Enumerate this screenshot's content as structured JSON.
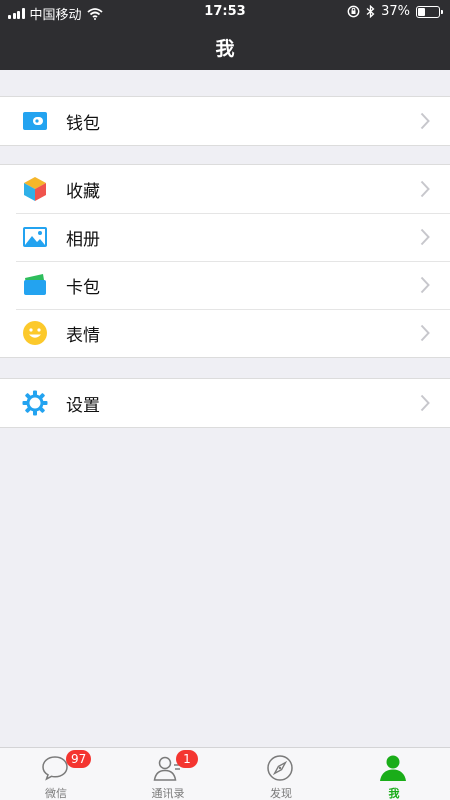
{
  "status_bar": {
    "carrier": "中国移动",
    "time": "17:53",
    "battery": "37%",
    "battery_level": 0.37
  },
  "nav": {
    "title": "我"
  },
  "groups": [
    {
      "items": [
        {
          "label": "钱包",
          "icon": "wallet-icon"
        }
      ]
    },
    {
      "items": [
        {
          "label": "收藏",
          "icon": "favorites-cube-icon"
        },
        {
          "label": "相册",
          "icon": "album-picture-icon"
        },
        {
          "label": "卡包",
          "icon": "card-wallet-icon"
        },
        {
          "label": "表情",
          "icon": "smiley-face-icon"
        }
      ]
    },
    {
      "items": [
        {
          "label": "设置",
          "icon": "settings-gear-icon"
        }
      ]
    }
  ],
  "tabbar": {
    "tabs": [
      {
        "label": "微信",
        "icon": "chat-bubble-icon",
        "badge": "97"
      },
      {
        "label": "通讯录",
        "icon": "contacts-icon",
        "badge": "1"
      },
      {
        "label": "发现",
        "icon": "compass-icon"
      },
      {
        "label": "我",
        "icon": "person-icon",
        "active": true
      }
    ]
  },
  "colors": {
    "header_bg": "#2e2e31",
    "page_bg": "#efeff4",
    "active_tab": "#1aad19",
    "badge": "#f43530",
    "icon_blue": "#23a3f0"
  }
}
